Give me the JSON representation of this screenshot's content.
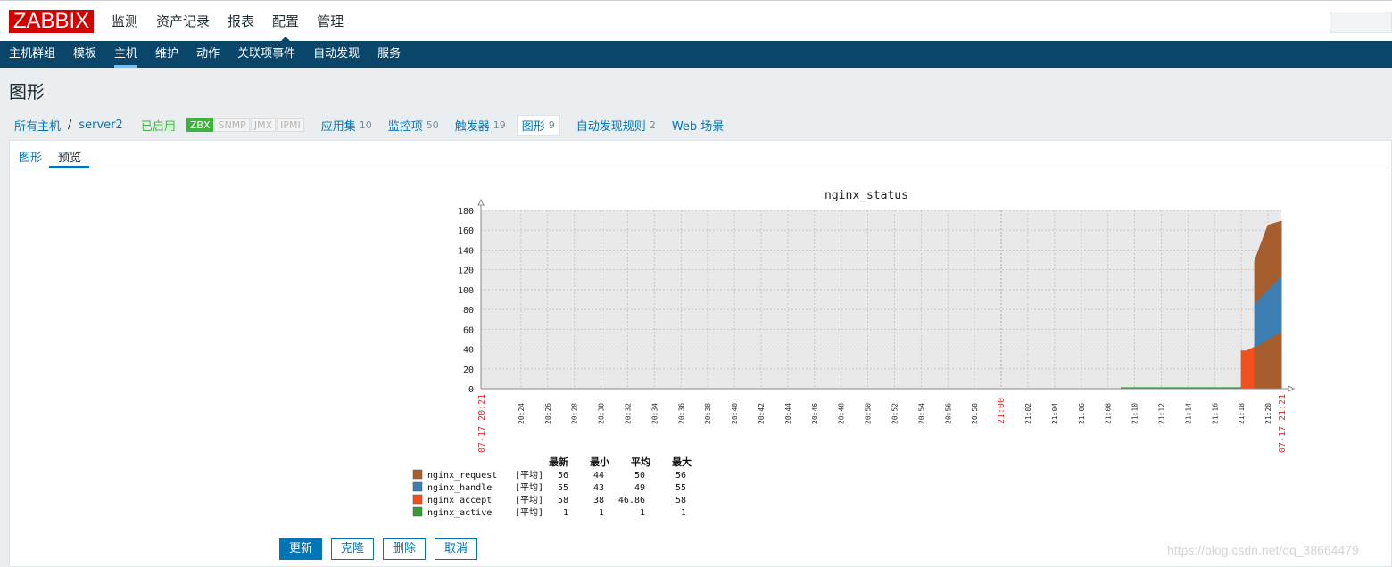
{
  "brand": {
    "logo_text": "ZABBIX",
    "accent": "#d40000",
    "nav_bg": "#0a466a"
  },
  "topnav": [
    {
      "label": "监测",
      "active": false
    },
    {
      "label": "资产记录",
      "active": false
    },
    {
      "label": "报表",
      "active": false
    },
    {
      "label": "配置",
      "active": true
    },
    {
      "label": "管理",
      "active": false
    }
  ],
  "subnav": [
    {
      "label": "主机群组",
      "active": false
    },
    {
      "label": "模板",
      "active": false
    },
    {
      "label": "主机",
      "active": true
    },
    {
      "label": "维护",
      "active": false
    },
    {
      "label": "动作",
      "active": false
    },
    {
      "label": "关联项事件",
      "active": false
    },
    {
      "label": "自动发现",
      "active": false
    },
    {
      "label": "服务",
      "active": false
    }
  ],
  "page": {
    "title": "图形"
  },
  "breadcrumb": {
    "all_hosts": "所有主机",
    "separator": "/",
    "host": "server2",
    "status": "已启用",
    "badges": [
      {
        "label": "ZBX",
        "on": true
      },
      {
        "label": "SNMP",
        "on": false
      },
      {
        "label": "JMX",
        "on": false
      },
      {
        "label": "IPMI",
        "on": false
      }
    ],
    "links": [
      {
        "label": "应用集",
        "count": "10",
        "current": false
      },
      {
        "label": "监控项",
        "count": "50",
        "current": false
      },
      {
        "label": "触发器",
        "count": "19",
        "current": false
      },
      {
        "label": "图形",
        "count": "9",
        "current": true
      },
      {
        "label": "自动发现规则",
        "count": "2",
        "current": false
      },
      {
        "label": "Web 场景",
        "count": "",
        "current": false
      }
    ]
  },
  "tabs": [
    {
      "label": "图形",
      "active": false
    },
    {
      "label": "预览",
      "active": true
    }
  ],
  "chart_data": {
    "type": "area",
    "title": "nginx_status",
    "xlabel": "",
    "ylabel": "",
    "ylim": [
      0,
      180
    ],
    "y_ticks": [
      "0",
      "20",
      "40",
      "60",
      "80",
      "100",
      "120",
      "140",
      "160",
      "180"
    ],
    "grid": true,
    "x_ticks": [
      "20:24",
      "20:26",
      "20:28",
      "20:30",
      "20:32",
      "20:34",
      "20:36",
      "20:38",
      "20:40",
      "20:42",
      "20:44",
      "20:46",
      "20:48",
      "20:50",
      "20:52",
      "20:54",
      "20:56",
      "20:58",
      "21:00",
      "21:02",
      "21:04",
      "21:06",
      "21:08",
      "21:10",
      "21:12",
      "21:14",
      "21:16",
      "21:18",
      "21:20"
    ],
    "x_start_label": "07-17 20:21",
    "x_end_label": "07-17 21:21",
    "x_minutes": [
      0,
      60
    ],
    "series": [
      {
        "name": "nginx_active",
        "color": "#3a9a3a",
        "points": [
          [
            48,
            1
          ],
          [
            60,
            1
          ]
        ]
      },
      {
        "name": "nginx_accept",
        "color": "#f24f1d",
        "points": [
          [
            57,
            38
          ],
          [
            57.4,
            38
          ],
          [
            58,
            42
          ],
          [
            60,
            58
          ]
        ]
      },
      {
        "name": "nginx_handle",
        "color": "#3d7fb2",
        "points": [
          [
            58,
            43
          ],
          [
            60,
            55
          ]
        ]
      },
      {
        "name": "nginx_request",
        "color": "#a65e2e",
        "points": [
          [
            58,
            44
          ],
          [
            59,
            60
          ],
          [
            59.5,
            56
          ],
          [
            60,
            56
          ]
        ]
      }
    ],
    "legend": {
      "headers": [
        "最新",
        "最小",
        "平均",
        "最大"
      ],
      "rows": [
        {
          "name": "nginx_request",
          "func": "[平均]",
          "last": "56",
          "min": "44",
          "avg": "50",
          "max": "56",
          "color": "#a65e2e"
        },
        {
          "name": "nginx_handle",
          "func": "[平均]",
          "last": "55",
          "min": "43",
          "avg": "49",
          "max": "55",
          "color": "#3d7fb2"
        },
        {
          "name": "nginx_accept",
          "func": "[平均]",
          "last": "58",
          "min": "38",
          "avg": "46.86",
          "max": "58",
          "color": "#f24f1d"
        },
        {
          "name": "nginx_active",
          "func": "[平均]",
          "last": "1",
          "min": "1",
          "avg": "1",
          "max": "1",
          "color": "#3a9a3a"
        }
      ]
    }
  },
  "buttons": {
    "update": "更新",
    "clone": "克隆",
    "delete": "删除",
    "cancel": "取消"
  },
  "watermark": "https://blog.csdn.net/qq_38664479"
}
